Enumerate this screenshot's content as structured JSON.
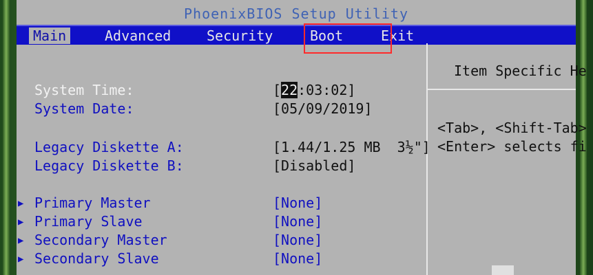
{
  "window": {
    "title": "PhoenixBIOS Setup Utility"
  },
  "menu": {
    "tabs": [
      {
        "label": "Main"
      },
      {
        "label": "Advanced"
      },
      {
        "label": "Security"
      },
      {
        "label": "Boot"
      },
      {
        "label": "Exit"
      }
    ]
  },
  "main": {
    "time": {
      "label": "System Time:",
      "value_hour": "22",
      "value_rest": ":03:02]",
      "value_open": "["
    },
    "date": {
      "label": "System Date:",
      "value": "[05/09/2019]"
    },
    "disk_a": {
      "label": "Legacy Diskette A:",
      "value": "[1.44/1.25 MB  3½\"]"
    },
    "disk_b": {
      "label": "Legacy Diskette B:",
      "value": "[Disabled]"
    },
    "ide": [
      {
        "label": "Primary Master",
        "value": "[None]"
      },
      {
        "label": "Primary Slave",
        "value": "[None]"
      },
      {
        "label": "Secondary Master",
        "value": "[None]"
      },
      {
        "label": "Secondary Slave",
        "value": "[None]"
      }
    ]
  },
  "help": {
    "title": "Item Specific He",
    "lines": [
      "<Tab>, <Shift-Tab>",
      "<Enter> selects fi"
    ]
  },
  "colors": {
    "menubar": "#1010c8",
    "panel": "#b3b3b3",
    "highlight": "#ff2a2a"
  }
}
